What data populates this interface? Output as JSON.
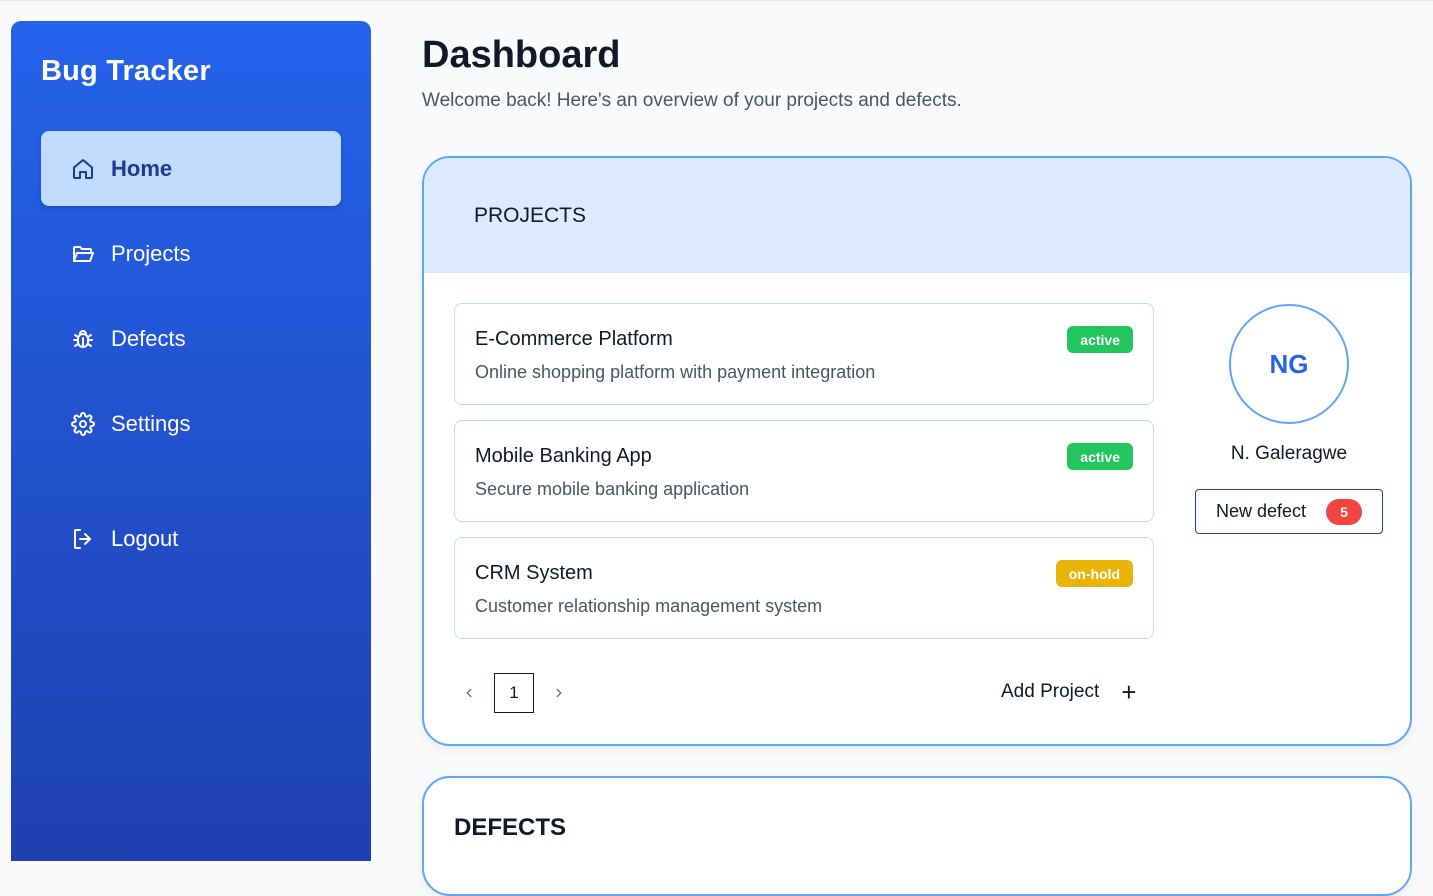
{
  "app": {
    "title": "Bug Tracker"
  },
  "sidebar": {
    "items": [
      {
        "label": "Home",
        "icon": "home-icon",
        "active": true
      },
      {
        "label": "Projects",
        "icon": "folder-open-icon",
        "active": false
      },
      {
        "label": "Defects",
        "icon": "bug-icon",
        "active": false
      },
      {
        "label": "Settings",
        "icon": "gear-icon",
        "active": false
      },
      {
        "label": "Logout",
        "icon": "logout-icon",
        "active": false
      }
    ]
  },
  "main": {
    "title": "Dashboard",
    "subtitle": "Welcome back! Here's an overview of your projects and defects."
  },
  "projects_panel": {
    "header": "PROJECTS",
    "projects": [
      {
        "name": "E-Commerce Platform",
        "description": "Online shopping platform with payment integration",
        "status": "active"
      },
      {
        "name": "Mobile Banking App",
        "description": "Secure mobile banking application",
        "status": "active"
      },
      {
        "name": "CRM System",
        "description": "Customer relationship management system",
        "status": "on-hold"
      }
    ],
    "pagination": {
      "current_page": "1",
      "prev_icon": "chevron-left-icon",
      "next_icon": "chevron-right-icon"
    },
    "add_project_label": "Add Project"
  },
  "user": {
    "initials": "NG",
    "name": "N. Galeragwe",
    "new_defect_label": "New defect",
    "new_defect_count": "5"
  },
  "defects_panel": {
    "header": "DEFECTS"
  },
  "colors": {
    "sidebar_top": "#2563eb",
    "sidebar_bottom": "#1e40af",
    "active_nav": "#bfdbfe",
    "panel_border": "#60a5fa",
    "panel_header": "#dbeafe",
    "status_active": "#22c55e",
    "status_on_hold": "#eab308",
    "count_badge": "#ef4444"
  }
}
